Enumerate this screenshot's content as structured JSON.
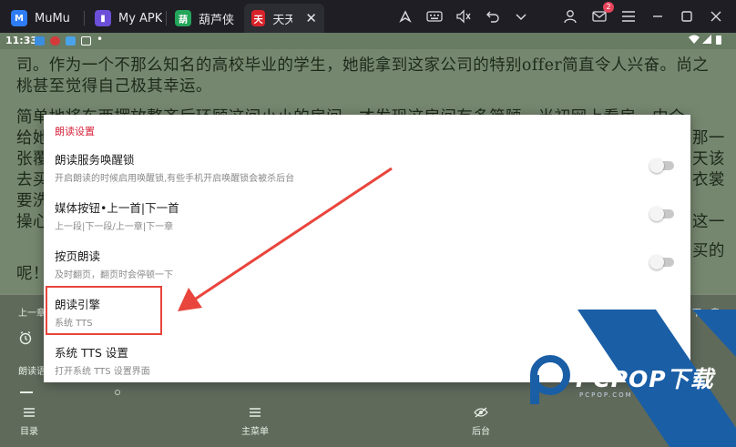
{
  "tabs": [
    {
      "label": "MuMu",
      "icon": "mumu-icon",
      "color": "#2e7cf6"
    },
    {
      "label": "My APK",
      "icon": "myapk-icon",
      "color": "#6b4fd8"
    },
    {
      "label": "葫芦侠",
      "icon": "huluxia-icon",
      "color": "#23a55a"
    },
    {
      "label": "天天",
      "icon": "reader-app-icon",
      "color": "#d8232a",
      "active": true
    }
  ],
  "titlebar": {
    "mail_badge": "2"
  },
  "statusbar": {
    "time": "11:33"
  },
  "reader": {
    "lines": [
      "司。作为一个不那么知名的高校毕业的学生，她能拿到这家公司的特别offer简直令人兴奋。尚之",
      "桃甚至觉得自己极其幸运。",
      "        简单地将东西摆放整齐后环顾这间小小的房间，才发现这房间有多简陋。当初网上看房，中介",
      "给她",
      "张覆",
      "去买",
      "要洗",
      "操心",
      "呢！"
    ],
    "right_fragments": [
      "那一",
      "天该",
      "衣裳",
      "这一",
      "买的"
    ]
  },
  "panel": {
    "prev_chapter": "上一章",
    "next_chapter": "下一章",
    "read_speed": "朗读语速",
    "nav": [
      {
        "label": "目录",
        "icon": "list-icon"
      },
      {
        "label": "主菜单",
        "icon": "menu-icon"
      },
      {
        "label": "后台",
        "icon": "eye-off-icon"
      }
    ]
  },
  "dialog": {
    "title": "朗读设置",
    "rows": [
      {
        "title": "朗读服务唤醒锁",
        "subtitle": "开启朗读的时候启用唤醒锁,有些手机开启唤醒锁会被杀后台",
        "toggle": false
      },
      {
        "title": "媒体按钮•上一首|下一首",
        "subtitle": "上一段|下一段/上一章|下一章",
        "toggle": false
      },
      {
        "title": "按页朗读",
        "subtitle": "及时翻页，翻页时会停顿一下",
        "toggle": false
      },
      {
        "title": "朗读引擎",
        "subtitle": "系统 TTS"
      },
      {
        "title": "系统 TTS 设置",
        "subtitle": "打开系统 TTS 设置界面"
      }
    ]
  },
  "watermark": {
    "text": "PCPOP下载",
    "sub": "PCPOP.COM"
  }
}
